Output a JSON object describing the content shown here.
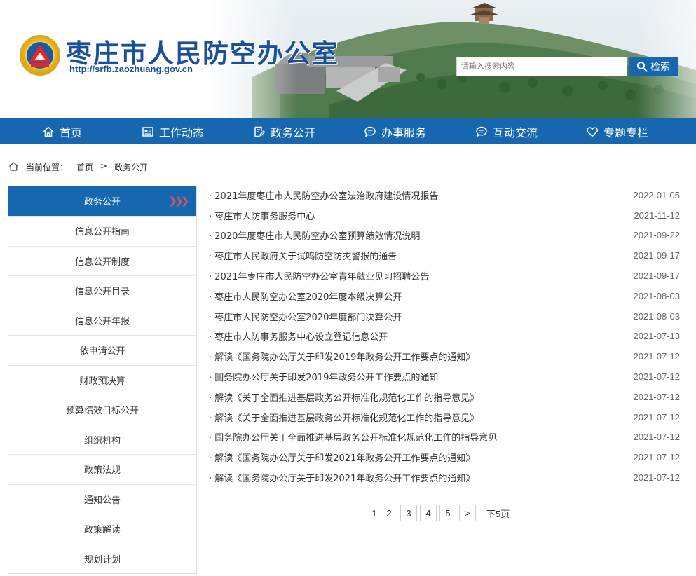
{
  "header": {
    "site_title": "枣庄市人民防空办公室",
    "site_url": "http://srfb.zaozhuang.gov.cn",
    "search_placeholder": "请输入搜索内容",
    "search_button": "检索"
  },
  "nav": [
    {
      "label": "首页",
      "icon": "home-icon"
    },
    {
      "label": "工作动态",
      "icon": "newspaper-icon"
    },
    {
      "label": "政务公开",
      "icon": "document-edit-icon"
    },
    {
      "label": "办事服务",
      "icon": "chat-bubble-icon"
    },
    {
      "label": "互动交流",
      "icon": "chat-bubble-icon"
    },
    {
      "label": "专题专栏",
      "icon": "heart-icon"
    }
  ],
  "breadcrumb": {
    "prefix": "当前位置：",
    "home": "首页",
    "separator": ">",
    "current": "政务公开"
  },
  "sidebar": {
    "active": "政务公开",
    "items": [
      "信息公开指南",
      "信息公开制度",
      "信息公开目录",
      "信息公开年报",
      "依申请公开",
      "财政预决算",
      "预算绩效目标公开",
      "组织机构",
      "政策法规",
      "通知公告",
      "政策解读",
      "规划计划"
    ]
  },
  "articles": [
    {
      "title": "· 2021年度枣庄市人民防空办公室法治政府建设情况报告",
      "date": "2022-01-05"
    },
    {
      "title": "· 枣庄市人防事务服务中心",
      "date": "2021-11-12"
    },
    {
      "title": "· 2020年度枣庄市人民防空办公室预算绩效情况说明",
      "date": "2021-09-22"
    },
    {
      "title": "· 枣庄市人民政府关于试鸣防空防灾警报的通告",
      "date": "2021-09-17"
    },
    {
      "title": "· 2021年枣庄市人民防空办公室青年就业见习招聘公告",
      "date": "2021-09-17"
    },
    {
      "title": "· 枣庄市人民防空办公室2020年度本级决算公开",
      "date": "2021-08-03"
    },
    {
      "title": "· 枣庄市人民防空办公室2020年度部门决算公开",
      "date": "2021-08-03"
    },
    {
      "title": "· 枣庄市人防事务服务中心设立登记信息公开",
      "date": "2021-07-13"
    },
    {
      "title": "· 解读《国务院办公厅关于印发2019年政务公开工作要点的通知》",
      "date": "2021-07-12"
    },
    {
      "title": "· 国务院办公厅关于印发2019年政务公开工作要点的通知",
      "date": "2021-07-12"
    },
    {
      "title": "· 解读《关于全面推进基层政务公开标准化规范化工作的指导意见》",
      "date": "2021-07-12"
    },
    {
      "title": "· 解读《关于全面推进基层政务公开标准化规范化工作的指导意见》",
      "date": "2021-07-12"
    },
    {
      "title": "· 国务院办公厅关于全面推进基层政务公开标准化规范化工作的指导意见",
      "date": "2021-07-12"
    },
    {
      "title": "· 解读《国务院办公厅关于印发2021年政务公开工作要点的通知》",
      "date": "2021-07-12"
    },
    {
      "title": "· 解读《国务院办公厅关于印发2021年政务公开工作要点的通知》",
      "date": "2021-07-12"
    }
  ],
  "pagination": {
    "current": "1",
    "pages": [
      "2",
      "3",
      "4",
      "5"
    ],
    "next": ">",
    "jump": "下5页"
  },
  "colors": {
    "primary": "#1767b0",
    "title_blue": "#1b4f9c",
    "accent_red": "#e8554e"
  }
}
